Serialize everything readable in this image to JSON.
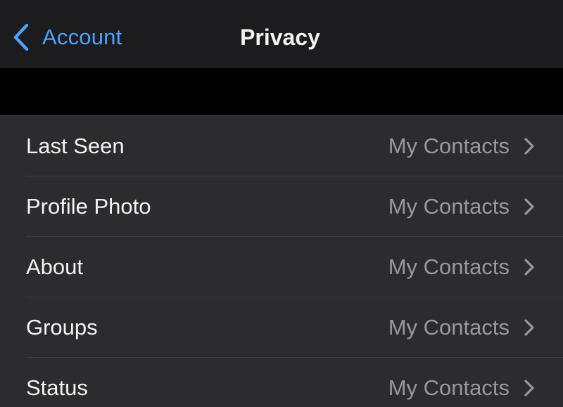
{
  "nav": {
    "back_label": "Account",
    "title": "Privacy"
  },
  "colors": {
    "accent": "#4aa3ff",
    "background": "#000000",
    "nav_background": "#1c1c1e",
    "row_background": "#2c2c2e",
    "text_primary": "#f2f2f7",
    "text_secondary": "#98989d"
  },
  "icons": {
    "back": "chevron-left-icon",
    "row_disclosure": "chevron-right-icon"
  },
  "rows": [
    {
      "label": "Last Seen",
      "value": "My Contacts"
    },
    {
      "label": "Profile Photo",
      "value": "My Contacts"
    },
    {
      "label": "About",
      "value": "My Contacts"
    },
    {
      "label": "Groups",
      "value": "My Contacts"
    },
    {
      "label": "Status",
      "value": "My Contacts"
    }
  ]
}
